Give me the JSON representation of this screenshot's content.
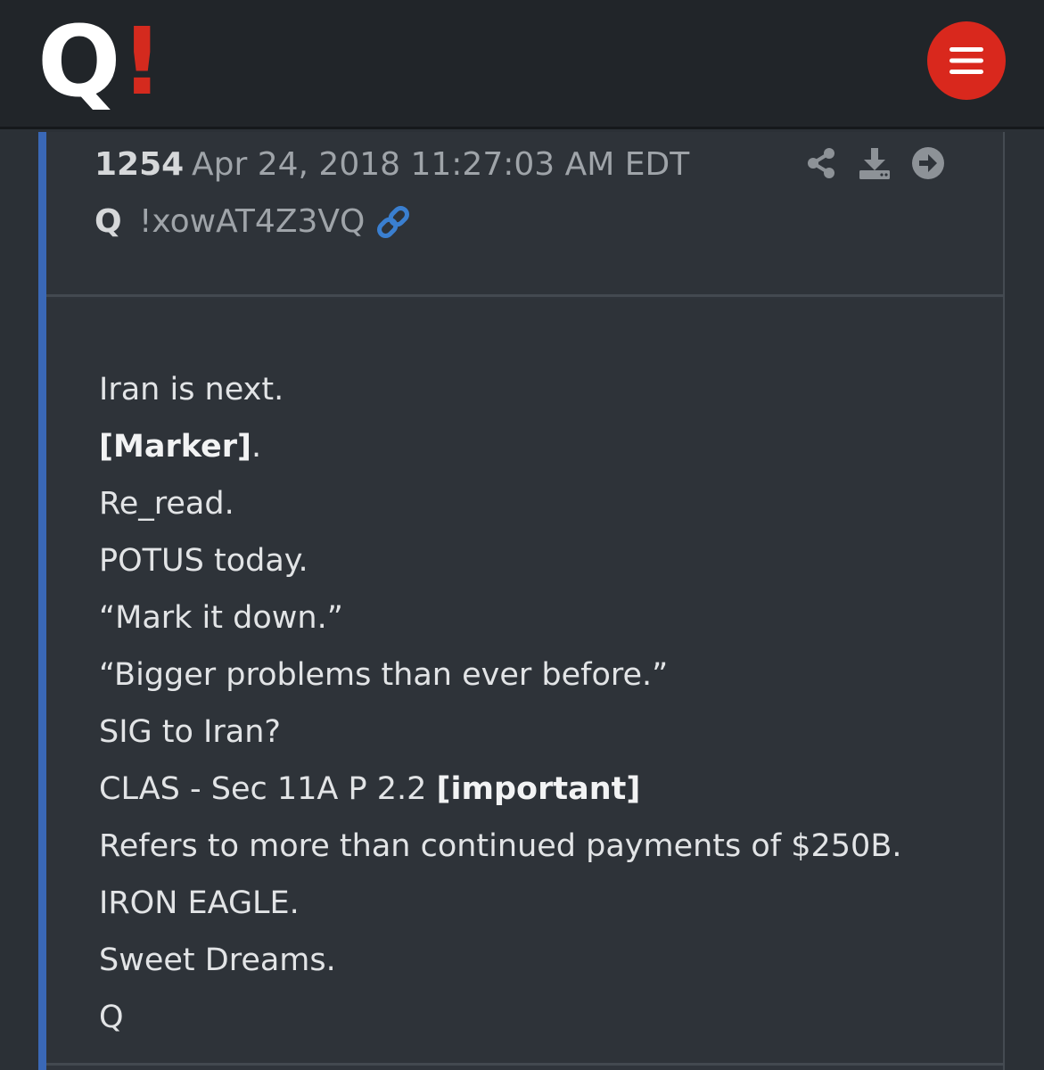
{
  "header": {
    "logo_q": "Q",
    "logo_bang": "!",
    "menu_icon": "hamburger-icon",
    "colors": {
      "bar": "#212529",
      "accent_red": "#d9281d"
    }
  },
  "post": {
    "number": "1254",
    "timestamp": "Apr 24, 2018 11:27:03 AM EDT",
    "author": "Q",
    "tripcode": "!xowAT4Z3VQ",
    "link_icon": "link-icon",
    "actions": [
      "share-icon",
      "download-icon",
      "arrow-right-circle-icon"
    ],
    "accent_color": "#3a68b6",
    "lines": [
      {
        "text": "Iran is next.",
        "bold": ""
      },
      {
        "text": "",
        "bold": "[Marker]",
        "after": "."
      },
      {
        "text": "Re_read.",
        "bold": ""
      },
      {
        "text": "POTUS today.",
        "bold": ""
      },
      {
        "text": "“Mark it down.”",
        "bold": ""
      },
      {
        "text": "“Bigger problems than ever before.”",
        "bold": ""
      },
      {
        "text": "SIG to Iran?",
        "bold": ""
      },
      {
        "text": "CLAS - Sec 11A P 2.2 ",
        "bold": "[important]"
      },
      {
        "text": "Refers to more than continued payments of $250B.",
        "bold": ""
      },
      {
        "text": "IRON EAGLE.",
        "bold": ""
      },
      {
        "text": "Sweet Dreams.",
        "bold": ""
      },
      {
        "text": "Q",
        "bold": ""
      }
    ]
  }
}
